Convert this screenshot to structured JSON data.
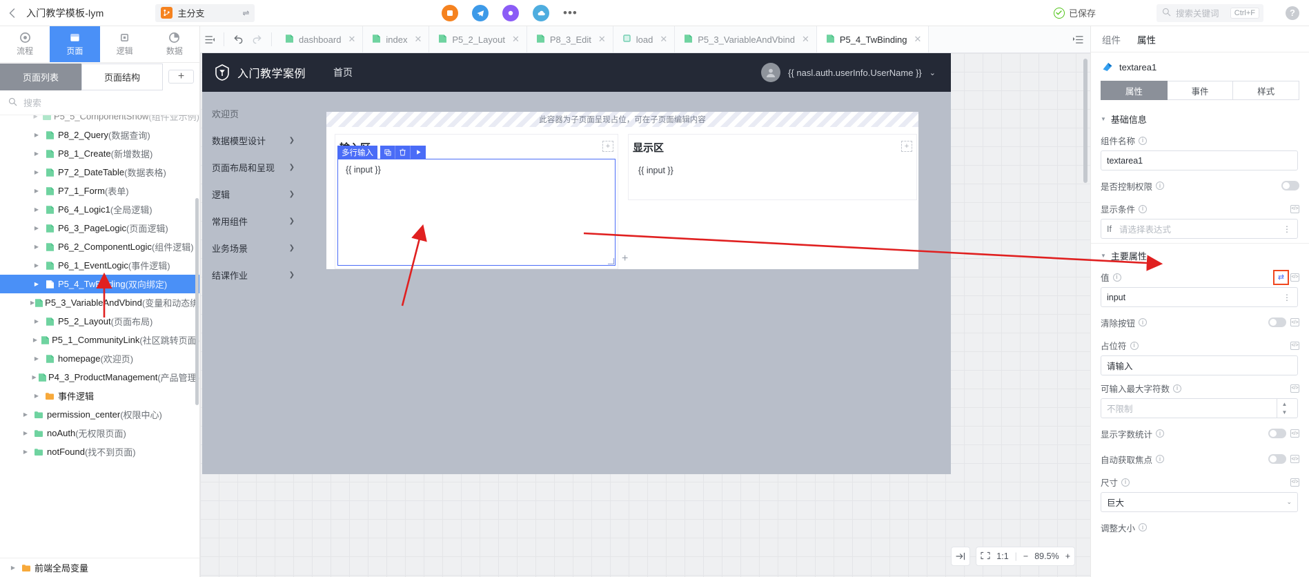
{
  "topbar": {
    "back_icon": "chevron-left-icon",
    "title": "入门教学模板-lym",
    "branch": {
      "icon": "branch-icon",
      "name": "主分支",
      "swap_icon": "swap-icon"
    },
    "center_icons": [
      "orange-circle-icon",
      "telegram-icon",
      "purple-circle-icon",
      "cloud-icon",
      "more-dots-icon"
    ],
    "saved_label": "已保存",
    "saved_icon": "check-circle-icon",
    "search": {
      "icon": "search-icon",
      "placeholder": "搜索关键词",
      "shortcut": "Ctrl+F"
    },
    "help_icon": "help-circle-icon",
    "help_label": "?"
  },
  "left": {
    "rail": [
      {
        "label": "流程",
        "icon": "flow-icon",
        "active": false
      },
      {
        "label": "页面",
        "icon": "page-icon",
        "active": true
      },
      {
        "label": "逻辑",
        "icon": "logic-icon",
        "active": false
      },
      {
        "label": "数据",
        "icon": "data-icon",
        "active": false
      }
    ],
    "segments": [
      {
        "label": "页面列表",
        "active": true
      },
      {
        "label": "页面结构",
        "active": false
      }
    ],
    "add_label": "+",
    "search": {
      "icon": "search-icon",
      "placeholder": "搜索"
    },
    "tree": [
      {
        "name": "P5_5_ComponentShow",
        "desc": "(组件业示例)",
        "icon": "folder-green-icon",
        "level": 1,
        "selected": false,
        "clipped": true
      },
      {
        "name": "P8_2_Query",
        "desc": "(数据查询)",
        "icon": "page-file-icon",
        "level": 1,
        "selected": false
      },
      {
        "name": "P8_1_Create",
        "desc": "(新增数据)",
        "icon": "page-file-icon",
        "level": 1,
        "selected": false
      },
      {
        "name": "P7_2_DateTable",
        "desc": "(数据表格)",
        "icon": "page-file-icon",
        "level": 1,
        "selected": false
      },
      {
        "name": "P7_1_Form",
        "desc": "(表单)",
        "icon": "page-file-icon",
        "level": 1,
        "selected": false
      },
      {
        "name": "P6_4_Logic1",
        "desc": "(全局逻辑)",
        "icon": "page-file-icon",
        "level": 1,
        "selected": false
      },
      {
        "name": "P6_3_PageLogic",
        "desc": "(页面逻辑)",
        "icon": "page-file-icon",
        "level": 1,
        "selected": false
      },
      {
        "name": "P6_2_ComponentLogic",
        "desc": "(组件逻辑)",
        "icon": "page-file-icon",
        "level": 1,
        "selected": false
      },
      {
        "name": "P6_1_EventLogic",
        "desc": "(事件逻辑)",
        "icon": "page-file-icon",
        "level": 1,
        "selected": false
      },
      {
        "name": "P5_4_TwBinding",
        "desc": "(双向绑定)",
        "icon": "page-file-icon",
        "level": 1,
        "selected": true
      },
      {
        "name": "P5_3_VariableAndVbind",
        "desc": "(变量和动态绑定)",
        "icon": "page-file-icon",
        "level": 1,
        "selected": false
      },
      {
        "name": "P5_2_Layout",
        "desc": "(页面布局)",
        "icon": "page-file-icon",
        "level": 1,
        "selected": false
      },
      {
        "name": "P5_1_CommunityLink",
        "desc": "(社区跳转页面)",
        "icon": "page-file-icon",
        "level": 1,
        "selected": false
      },
      {
        "name": "homepage",
        "desc": "(欢迎页)",
        "icon": "page-file-icon",
        "level": 1,
        "selected": false
      },
      {
        "name": "P4_3_ProductManagement",
        "desc": "(产品管理)",
        "icon": "page-file-icon",
        "level": 1,
        "selected": false
      },
      {
        "name": "事件逻辑",
        "desc": "",
        "icon": "folder-orange-icon",
        "level": 1,
        "selected": false
      },
      {
        "name": "permission_center",
        "desc": "(权限中心)",
        "icon": "folder-green-icon",
        "level": 0,
        "selected": false
      },
      {
        "name": "noAuth",
        "desc": "(无权限页面)",
        "icon": "folder-green-icon",
        "level": 0,
        "selected": false
      },
      {
        "name": "notFound",
        "desc": "(找不到页面)",
        "icon": "folder-green-icon",
        "level": 0,
        "selected": false
      }
    ],
    "footer_node": {
      "name": "前端全局变量",
      "icon": "folder-orange-icon"
    }
  },
  "center": {
    "toolbar": {
      "panel_toggle_icon": "panel-collapse-icon",
      "undo_icon": "undo-icon",
      "redo_icon": "redo-icon",
      "expand_icon": "tabs-list-icon"
    },
    "tabs": [
      {
        "label": "dashboard",
        "icon": "page-file-icon",
        "active": false,
        "closable": true
      },
      {
        "label": "index",
        "icon": "page-file-icon",
        "active": false,
        "closable": true
      },
      {
        "label": "P5_2_Layout",
        "icon": "page-file-icon",
        "active": false,
        "closable": true
      },
      {
        "label": "P8_3_Edit",
        "icon": "page-file-icon",
        "active": false,
        "closable": true
      },
      {
        "label": "load",
        "icon": "logic-node-icon",
        "active": false,
        "closable": true
      },
      {
        "label": "P5_3_VariableAndVbind",
        "icon": "page-file-icon",
        "active": false,
        "closable": true
      },
      {
        "label": "P5_4_TwBinding",
        "icon": "page-file-icon",
        "active": true,
        "closable": true
      }
    ],
    "preview": {
      "logo_icon": "shield-logo-icon",
      "brand": "入门教学案例",
      "nav": "首页",
      "avatar_icon": "user-avatar-icon",
      "username": "{{ nasl.auth.userInfo.UserName }}",
      "chevron_icon": "chevron-down-icon",
      "sidemenu": [
        {
          "label": "欢迎页",
          "arrow": false
        },
        {
          "label": "数据模型设计",
          "arrow": true
        },
        {
          "label": "页面布局和呈现",
          "arrow": true
        },
        {
          "label": "逻辑",
          "arrow": true
        },
        {
          "label": "常用组件",
          "arrow": true
        },
        {
          "label": "业务场景",
          "arrow": true
        },
        {
          "label": "结课作业",
          "arrow": true
        }
      ],
      "hatch_hint": "此容器为子页面呈现占位，可在子页面编辑内容",
      "input_card": {
        "title": "输入区",
        "plus": "+",
        "selected_tag": "多行输入",
        "actions": [
          "copy-icon",
          "delete-icon",
          "play-icon"
        ],
        "textarea_value": "{{ input }}"
      },
      "show_card": {
        "title": "显示区",
        "plus": "+",
        "value": "{{ input }}"
      },
      "section_plus": "+"
    },
    "zoomtools": {
      "collapse_icon": "collapse-right-icon",
      "fit_icon": "fit-screen-icon",
      "ratio": "1:1",
      "minus": "−",
      "zoom": "89.5%",
      "plus": "+"
    }
  },
  "right": {
    "tabs": [
      {
        "label": "组件",
        "on": false
      },
      {
        "label": "属性",
        "on": true
      }
    ],
    "component": {
      "icon": "textarea-component-icon",
      "name": "textarea1"
    },
    "segments": [
      {
        "label": "属性",
        "on": true
      },
      {
        "label": "事件",
        "on": false
      },
      {
        "label": "样式",
        "on": false
      }
    ],
    "sections": [
      {
        "title": "基础信息",
        "fields": [
          {
            "type": "text",
            "label": "组件名称",
            "info": true,
            "value": "textarea1"
          },
          {
            "type": "toggle",
            "label": "是否控制权限",
            "info": true,
            "on": false
          },
          {
            "type": "expr",
            "label": "显示条件",
            "info": true,
            "prefix": "If",
            "placeholder": "请选择表达式"
          }
        ]
      },
      {
        "title": "主要属性",
        "fields": [
          {
            "type": "value",
            "label": "值",
            "info": true,
            "value": "input",
            "swap_icon": "two-way-binding-icon",
            "code_icon": "code-icon",
            "highlight": true
          },
          {
            "type": "toggle",
            "label": "清除按钮",
            "info": true,
            "on": false,
            "code_icon": "code-icon"
          },
          {
            "type": "text",
            "label": "占位符",
            "info": true,
            "value": "请输入",
            "code_icon": "code-icon"
          },
          {
            "type": "stepper",
            "label": "可输入最大字符数",
            "info": true,
            "placeholder": "不限制",
            "code_icon": "code-icon"
          },
          {
            "type": "toggle",
            "label": "显示字数统计",
            "info": true,
            "on": false,
            "code_icon": "code-icon"
          },
          {
            "type": "toggle",
            "label": "自动获取焦点",
            "info": true,
            "on": false,
            "code_icon": "code-icon"
          },
          {
            "type": "select",
            "label": "尺寸",
            "info": true,
            "value": "巨大",
            "code_icon": "code-icon"
          },
          {
            "type": "label-only",
            "label": "调整大小",
            "info": true
          }
        ]
      }
    ]
  },
  "colors": {
    "accent": "#4a90f7",
    "selection": "#4a6cf7",
    "highlight": "#f0471f",
    "brand_dark": "#242936",
    "green_file": "#6fd3a0",
    "orange": "#f5821f",
    "arrow_red": "#e02020"
  }
}
